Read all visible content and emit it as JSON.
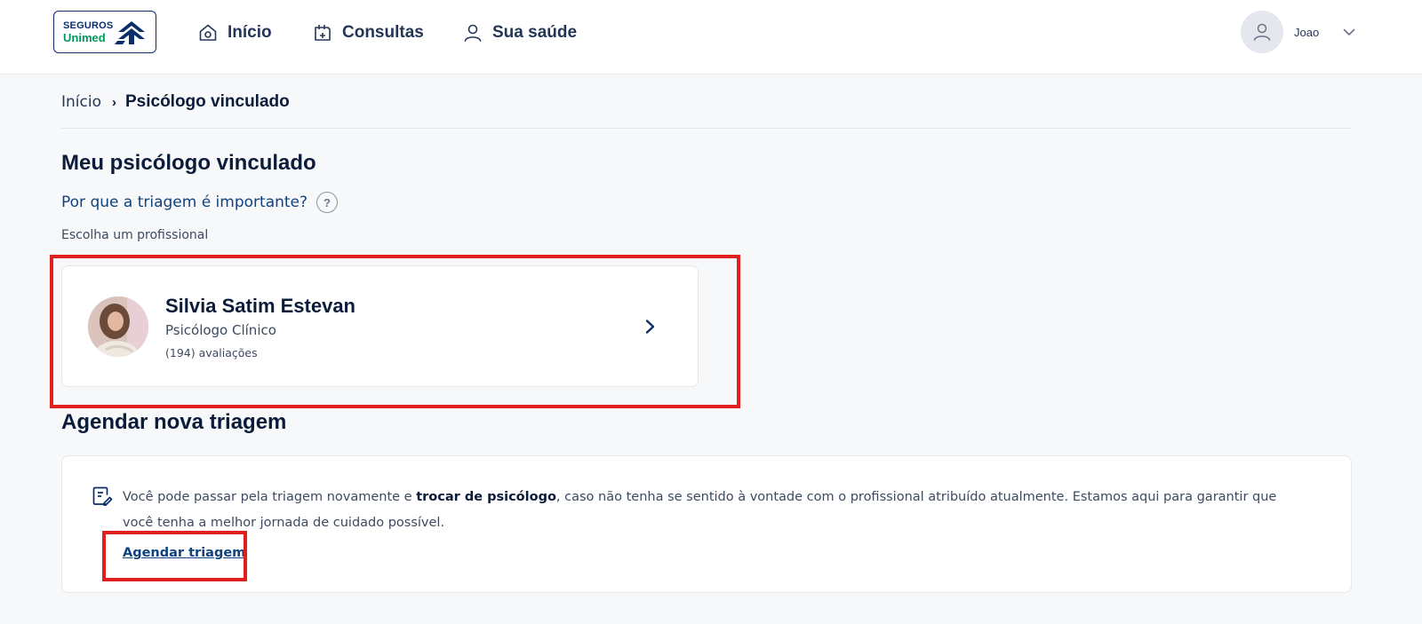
{
  "header": {
    "logo": {
      "line1": "SEGUROS",
      "line2": "Unimed"
    },
    "nav": [
      {
        "label": "Início",
        "icon": "home-icon"
      },
      {
        "label": "Consultas",
        "icon": "calendar-icon"
      },
      {
        "label": "Sua saúde",
        "icon": "person-icon"
      }
    ],
    "user": {
      "name": "Joao",
      "icon": "user-icon"
    }
  },
  "breadcrumb": {
    "home": "Início",
    "separator": "›",
    "current": "Psicólogo vinculado"
  },
  "page": {
    "title": "Meu psicólogo vinculado",
    "why_link": "Por que a triagem é importante?",
    "help_glyph": "?",
    "choose_label": "Escolha um profissional"
  },
  "professional": {
    "name": "Silvia Satim Estevan",
    "role": "Psicólogo Clínico",
    "reviews": "(194) avaliações"
  },
  "schedule_section": {
    "title": "Agendar nova triagem",
    "text_before": "Você pode passar pela triagem novamente e ",
    "text_bold": "trocar de psicólogo",
    "text_after": ", caso não tenha se sentido à vontade com o profissional atribuído atualmente. Estamos aqui para garantir que você tenha a melhor jornada de cuidado possível.",
    "link": "Agendar triagem"
  },
  "colors": {
    "brand_blue": "#0b2e6b",
    "brand_green": "#00995d",
    "link_blue": "#10427f",
    "highlight_red": "#e02020"
  }
}
